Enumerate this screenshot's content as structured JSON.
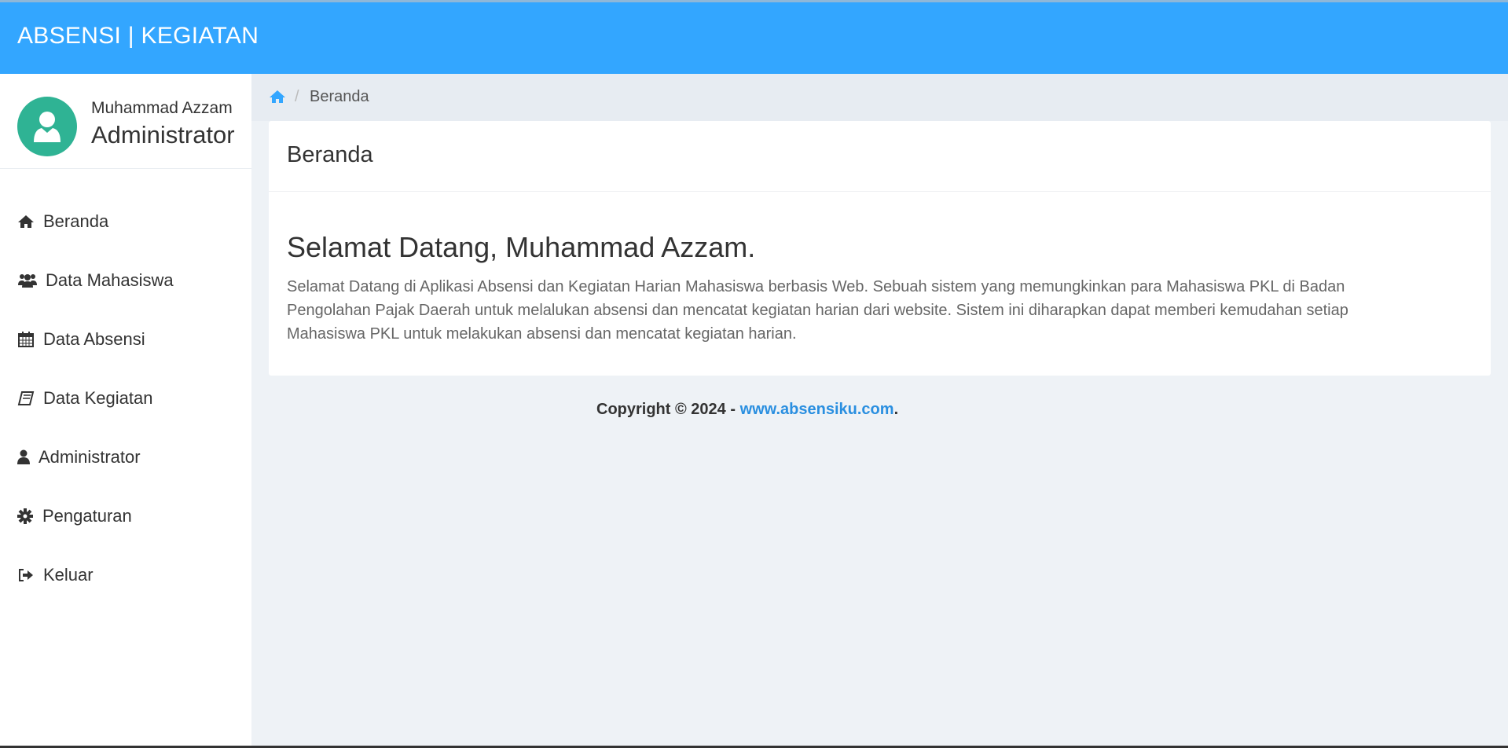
{
  "header": {
    "brand": "ABSENSI | KEGIATAN"
  },
  "user": {
    "name": "Muhammad Azzam",
    "role": "Administrator"
  },
  "sidebar": {
    "items": [
      {
        "label": "Beranda",
        "icon": "home-icon"
      },
      {
        "label": "Data Mahasiswa",
        "icon": "users-icon"
      },
      {
        "label": "Data Absensi",
        "icon": "calendar-icon"
      },
      {
        "label": "Data Kegiatan",
        "icon": "book-icon"
      },
      {
        "label": "Administrator",
        "icon": "user-icon"
      },
      {
        "label": "Pengaturan",
        "icon": "gear-icon"
      },
      {
        "label": "Keluar",
        "icon": "sign-out-icon"
      }
    ]
  },
  "breadcrumb": {
    "separator": "/",
    "current": "Beranda"
  },
  "card": {
    "title": "Beranda",
    "welcome": "Selamat Datang, Muhammad Azzam.",
    "description": "Selamat Datang di Aplikasi Absensi dan Kegiatan Harian Mahasiswa berbasis Web. Sebuah sistem yang memungkinkan para Mahasiswa PKL di Badan Pengolahan Pajak Daerah untuk melalukan absensi dan mencatat kegiatan harian dari website. Sistem ini diharapkan dapat memberi kemudahan setiap Mahasiswa PKL untuk melakukan absensi dan mencatat kegiatan harian."
  },
  "footer": {
    "copyright": "Copyright © 2024 - ",
    "link": "www.absensiku.com",
    "suffix": "."
  },
  "colors": {
    "header": "#33a6ff",
    "avatar": "#2fb394",
    "link": "#2a8fe0"
  }
}
